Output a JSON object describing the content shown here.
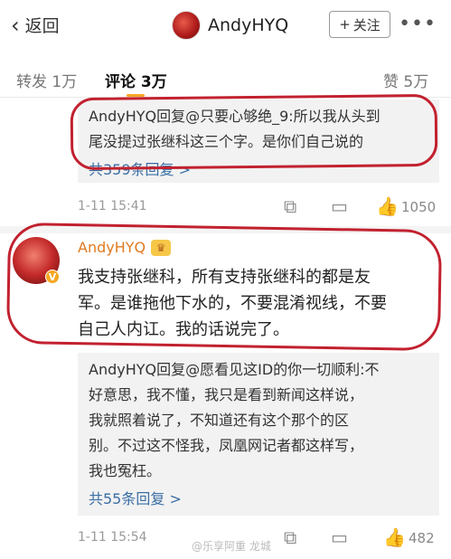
{
  "nav": {
    "back_label": "返回",
    "title": "AndyHYQ",
    "follow_label": "关注",
    "follow_icon": "+",
    "more_icon": "•••"
  },
  "tabs": {
    "repost": "转发 1万",
    "comments": "评论 3万",
    "likes": "赞 5万"
  },
  "reply1": {
    "line1": "AndyHYQ回复@只要心够绝_9:所以我从头到",
    "line2": "尾没提过张继科这三个字。是你们自己说的",
    "more": "共359条回复 >"
  },
  "meta1": {
    "time": "1-11 15:41",
    "like_count": "1050"
  },
  "comment": {
    "name": "AndyHYQ",
    "verified": "V",
    "lines": [
      "我支持张继科，所有支持张继科的都是友",
      "军。是谁拖他下水的，不要混淆视线，不要",
      "自己人内讧。我的话说完了。"
    ]
  },
  "reply2": {
    "lines": [
      "AndyHYQ回复@愿看见这ID的你一切顺利:不",
      "好意思，我不懂，我只是看到新闻这样说，",
      "我就照着说了，不知道还有这个那个的区",
      "别。不过这不怪我，凤凰网记者都这样写，",
      "我也冤枉。"
    ],
    "more": "共55条回复 >"
  },
  "meta2": {
    "time": "1-11 15:54",
    "like_count": "482"
  },
  "watermark": "@乐享阿重 龙城",
  "colors": {
    "accent": "#f5a623",
    "link": "#3a6ea5",
    "annotation": "#c2212f",
    "vip_name": "#e07a1f"
  }
}
